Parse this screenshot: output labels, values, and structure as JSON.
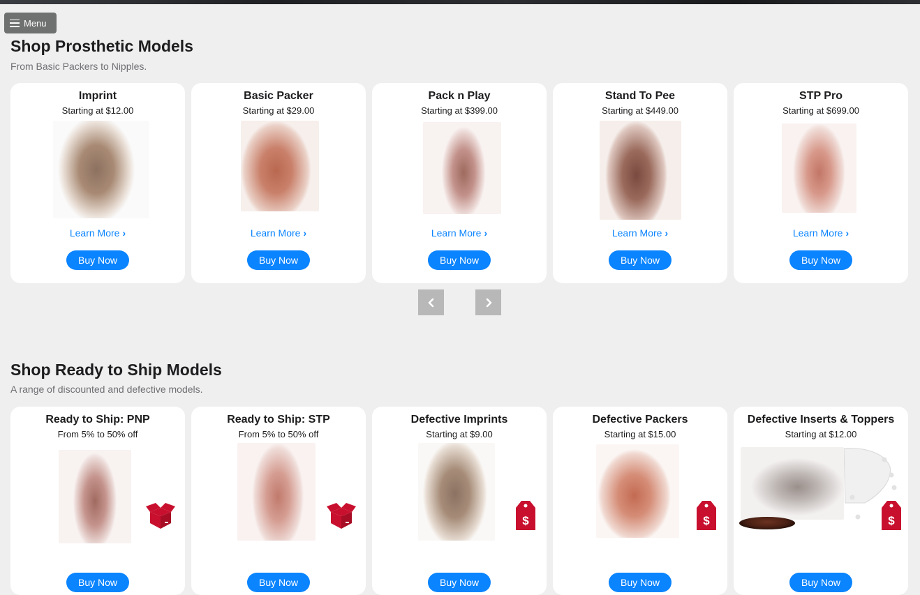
{
  "menu": {
    "label": "Menu",
    "icon": "hamburger-icon"
  },
  "section1": {
    "title": "Shop Prosthetic Models",
    "subtitle": "From Basic Packers to Nipples.",
    "cards": [
      {
        "title": "Imprint",
        "price": "Starting at $12.00",
        "learn_more": "Learn More",
        "buy": "Buy Now",
        "color": "#8d7160"
      },
      {
        "title": "Basic Packer",
        "price": "Starting at $29.00",
        "learn_more": "Learn More",
        "buy": "Buy Now",
        "color": "#b9684f"
      },
      {
        "title": "Pack n Play",
        "price": "Starting at $399.00",
        "learn_more": "Learn More",
        "buy": "Buy Now",
        "color": "#9e6a5e"
      },
      {
        "title": "Stand To Pee",
        "price": "Starting at $449.00",
        "learn_more": "Learn More",
        "buy": "Buy Now",
        "color": "#7a4a40"
      },
      {
        "title": "STP Pro",
        "price": "Starting at $699.00",
        "learn_more": "Learn More",
        "buy": "Buy Now",
        "color": "#c27666"
      }
    ],
    "prev_icon": "chevron-left-icon",
    "next_icon": "chevron-right-icon"
  },
  "section2": {
    "title": "Shop Ready to Ship Models",
    "subtitle": "A range of discounted and defective models.",
    "cards": [
      {
        "title": "Ready to Ship: PNP",
        "price": "From 5% to 50% off",
        "buy": "Buy Now",
        "badge": "open-box-icon",
        "color": "#a06a60"
      },
      {
        "title": "Ready to Ship: STP",
        "price": "From 5% to 50% off",
        "buy": "Buy Now",
        "badge": "open-box-icon",
        "color": "#c07a6c"
      },
      {
        "title": "Defective Imprints",
        "price": "Starting at $9.00",
        "buy": "Buy Now",
        "badge": "price-tag-icon",
        "color": "#8b7262"
      },
      {
        "title": "Defective Packers",
        "price": "Starting at $15.00",
        "buy": "Buy Now",
        "badge": "price-tag-icon",
        "color": "#c36a52"
      },
      {
        "title": "Defective Inserts & Toppers",
        "price": "Starting at $12.00",
        "buy": "Buy Now",
        "badge": "price-tag-icon",
        "color": "#9a8f8b"
      }
    ]
  },
  "colors": {
    "accent": "#0a84ff",
    "badge_red": "#c8102e",
    "background": "#efefef"
  }
}
